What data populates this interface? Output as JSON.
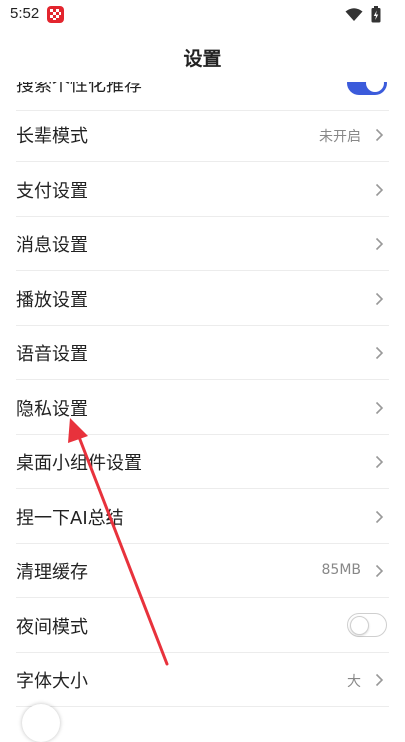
{
  "status_bar": {
    "time": "5:52"
  },
  "header": {
    "title": "设置"
  },
  "items": [
    {
      "label": "搜索个性化推荐",
      "control": "toggle-on"
    },
    {
      "label": "长辈模式",
      "value": "未开启"
    },
    {
      "label": "支付设置"
    },
    {
      "label": "消息设置"
    },
    {
      "label": "播放设置"
    },
    {
      "label": "语音设置"
    },
    {
      "label": "隐私设置"
    },
    {
      "label": "桌面小组件设置"
    },
    {
      "label": "捏一下AI总结"
    },
    {
      "label": "清理缓存",
      "value": "85MB"
    },
    {
      "label": "夜间模式",
      "control": "toggle-off"
    },
    {
      "label": "字体大小",
      "value": "大"
    }
  ],
  "colors": {
    "accent": "#3b5bdb",
    "annotation": "#e8323c",
    "app_icon": "#e3252e"
  }
}
